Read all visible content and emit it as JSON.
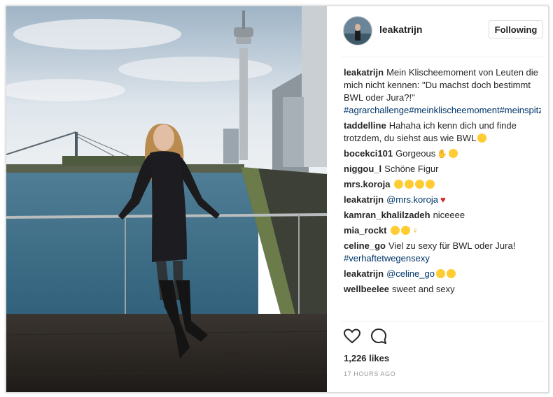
{
  "post": {
    "username": "leakatrijn",
    "follow_label": "Following",
    "likes": "1,226 likes",
    "timestamp": "17 HOURS AGO"
  },
  "comments": [
    {
      "user": "leakatrijn",
      "text": "Mein Klischeemoment von Leuten die mich nicht kennen: \"Du machst doch bestimmt BWL oder Jura?!\"",
      "tags": "#agrarchallenge#meinklischeemoment#meinspitznameistbauer#immerdiesebauern"
    },
    {
      "user": "taddelline",
      "text": "Hahaha ich kenn dich und finde trotzdem, du siehst aus wie BWL"
    },
    {
      "user": "bocekci101",
      "text": "Gorgeous"
    },
    {
      "user": "niggou_l",
      "text": "Schöne Figur"
    },
    {
      "user": "mrs.koroja",
      "text": ""
    },
    {
      "user": "leakatrijn",
      "mention": "@mrs.koroja"
    },
    {
      "user": "kamran_khalilzadeh",
      "text": "niceeee"
    },
    {
      "user": "mia_rockt",
      "text": ""
    },
    {
      "user": "celine_go",
      "text": "Viel zu sexy für BWL oder Jura!",
      "tags": "#verhaftetwegensexy"
    },
    {
      "user": "leakatrijn",
      "mention": "@celine_go"
    },
    {
      "user": "wellbeelee",
      "text": "sweet and sexy"
    }
  ],
  "icons": {
    "like": "heart-outline-icon",
    "comment": "speech-bubble-icon"
  },
  "colors": {
    "username": "#262626",
    "hashtag": "#003569",
    "timestamp": "#999999",
    "heart": "#d8232a"
  }
}
